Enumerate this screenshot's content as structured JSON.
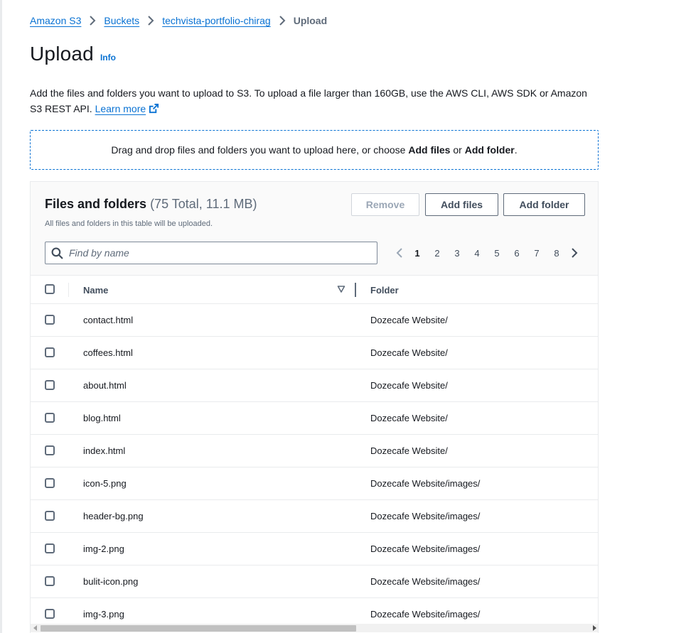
{
  "breadcrumb": {
    "items": [
      "Amazon S3",
      "Buckets",
      "techvista-portfolio-chirag"
    ],
    "current": "Upload"
  },
  "page": {
    "title": "Upload",
    "info_label": "Info",
    "description": "Add the files and folders you want to upload to S3. To upload a file larger than 160GB, use the AWS CLI, AWS SDK or Amazon S3 REST API.",
    "learn_more": "Learn more"
  },
  "dropzone": {
    "text_before": "Drag and drop files and folders you want to upload here, or choose ",
    "add_files": "Add files",
    "text_or": " or ",
    "add_folder": "Add folder",
    "text_end": "."
  },
  "files_panel": {
    "title": "Files and folders",
    "count": "(75 Total, 11.1 MB)",
    "subtitle": "All files and folders in this table will be uploaded.",
    "buttons": {
      "remove": "Remove",
      "add_files": "Add files",
      "add_folder": "Add folder"
    },
    "search_placeholder": "Find by name",
    "pagination": {
      "pages": [
        "1",
        "2",
        "3",
        "4",
        "5",
        "6",
        "7",
        "8"
      ],
      "current": "1"
    },
    "columns": {
      "name": "Name",
      "folder": "Folder"
    },
    "rows": [
      {
        "name": "contact.html",
        "folder": "Dozecafe Website/"
      },
      {
        "name": "coffees.html",
        "folder": "Dozecafe Website/"
      },
      {
        "name": "about.html",
        "folder": "Dozecafe Website/"
      },
      {
        "name": "blog.html",
        "folder": "Dozecafe Website/"
      },
      {
        "name": "index.html",
        "folder": "Dozecafe Website/"
      },
      {
        "name": "icon-5.png",
        "folder": "Dozecafe Website/images/"
      },
      {
        "name": "header-bg.png",
        "folder": "Dozecafe Website/images/"
      },
      {
        "name": "img-2.png",
        "folder": "Dozecafe Website/images/"
      },
      {
        "name": "bulit-icon.png",
        "folder": "Dozecafe Website/images/"
      },
      {
        "name": "img-3.png",
        "folder": "Dozecafe Website/images/"
      }
    ]
  },
  "colors": {
    "link": "#0972d3",
    "text": "#16191f",
    "muted": "#5f6b7a",
    "border": "#e9ebed"
  },
  "icons": {
    "breadcrumb_separator": "chevron-right-icon",
    "learn_more": "external-link-icon",
    "search": "search-icon",
    "prev_page": "chevron-left-icon",
    "next_page": "chevron-right-icon",
    "sort": "caret-down-icon"
  }
}
